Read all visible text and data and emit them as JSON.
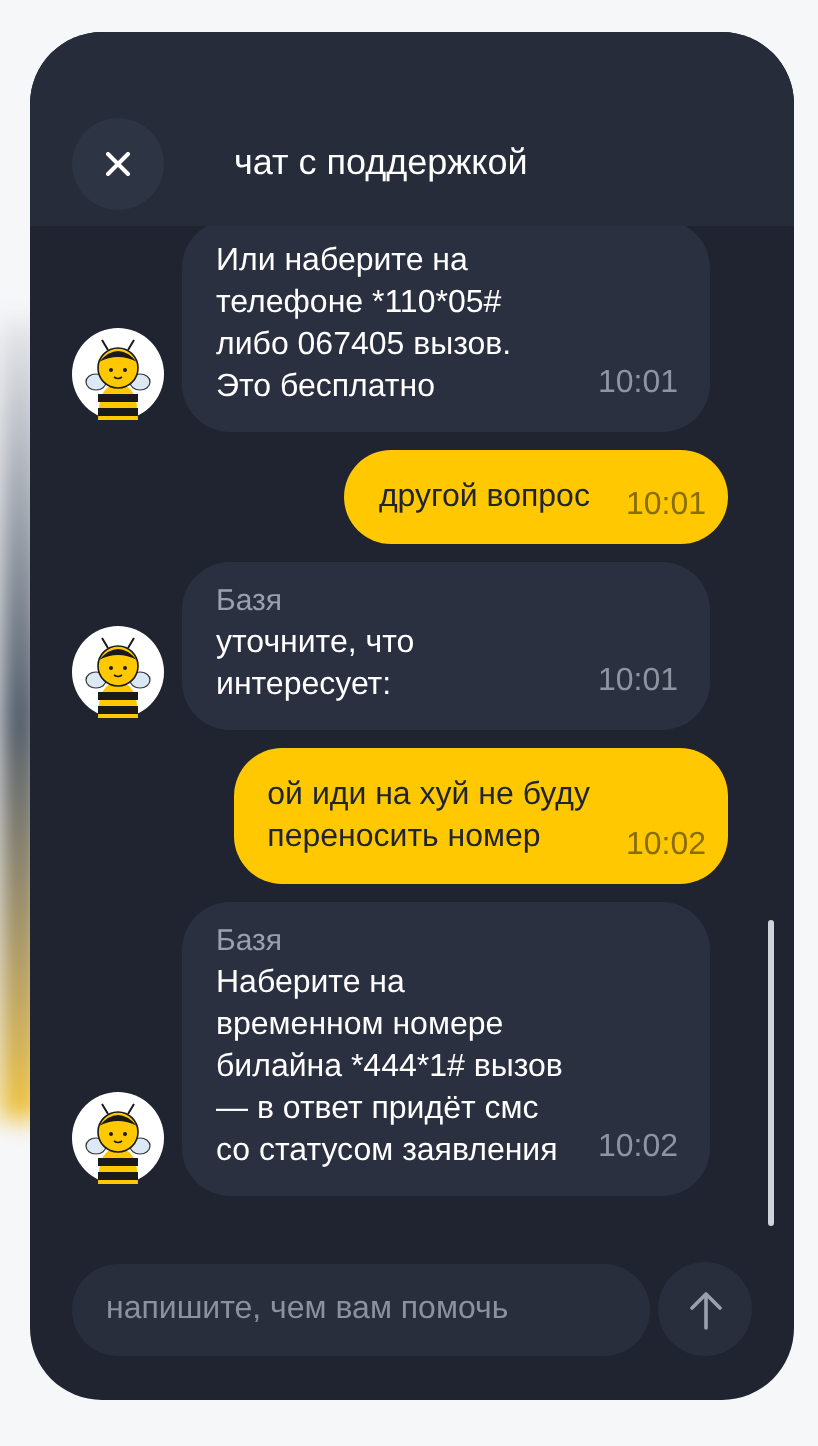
{
  "header": {
    "title": "чат с поддержкой"
  },
  "messages": [
    {
      "kind": "bot",
      "text": "Или наберите на\nтелефоне *110*05#\nлибо 067405 вызов.\nЭто бесплатно",
      "time": "10:01"
    },
    {
      "kind": "user",
      "text": "другой вопрос",
      "time": "10:01"
    },
    {
      "kind": "bot",
      "sender": "Базя",
      "text": "уточните, что\nинтересует:",
      "time": "10:01"
    },
    {
      "kind": "user",
      "text": "ой иди на хуй не буду\nпереносить номер",
      "time": "10:02"
    },
    {
      "kind": "bot",
      "sender": "Базя",
      "text": "Наберите на\nвременном номере\nбилайна *444*1# вызов\n— в ответ придёт смс\nсо статусом заявления",
      "time": "10:02"
    }
  ],
  "composer": {
    "placeholder": "напишите, чем вам помочь"
  }
}
